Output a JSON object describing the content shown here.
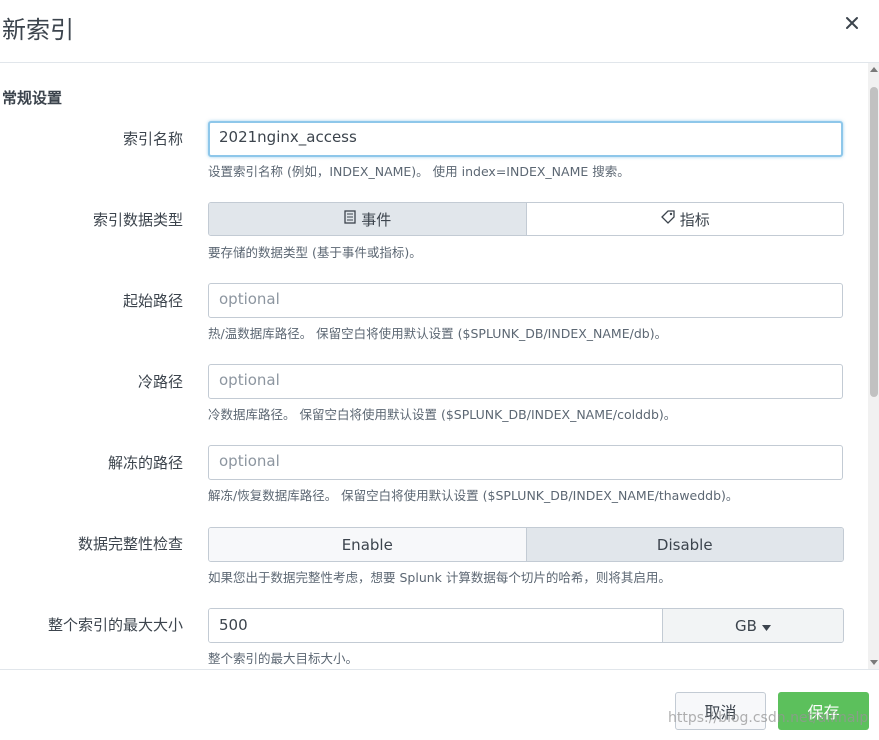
{
  "dialog": {
    "title": "新索引",
    "close_icon": "close-icon"
  },
  "section": {
    "title": "常规设置"
  },
  "index_name": {
    "label": "索引名称",
    "value": "2021nginx_access",
    "help": "设置索引名称 (例如，INDEX_NAME)。 使用 index=INDEX_NAME 搜索。"
  },
  "data_type": {
    "label": "索引数据类型",
    "options": [
      {
        "label": "事件",
        "icon": "document-icon",
        "selected": true
      },
      {
        "label": "指标",
        "icon": "tag-icon",
        "selected": false
      }
    ],
    "help": "要存储的数据类型 (基于事件或指标)。"
  },
  "home_path": {
    "label": "起始路径",
    "placeholder": "optional",
    "help": "热/温数据库路径。 保留空白将使用默认设置 ($SPLUNK_DB/INDEX_NAME/db)。"
  },
  "cold_path": {
    "label": "冷路径",
    "placeholder": "optional",
    "help": "冷数据库路径。 保留空白将使用默认设置 ($SPLUNK_DB/INDEX_NAME/colddb)。"
  },
  "thawed_path": {
    "label": "解冻的路径",
    "placeholder": "optional",
    "help": "解冻/恢复数据库路径。 保留空白将使用默认设置 ($SPLUNK_DB/INDEX_NAME/thaweddb)。"
  },
  "integrity": {
    "label": "数据完整性检查",
    "options": [
      {
        "label": "Enable",
        "selected": false
      },
      {
        "label": "Disable",
        "selected": true
      }
    ],
    "help": "如果您出于数据完整性考虑，想要 Splunk 计算数据每个切片的哈希，则将其启用。"
  },
  "max_size": {
    "label": "整个索引的最大大小",
    "value": "500",
    "unit": "GB",
    "help": "整个索引的最大目标大小。"
  },
  "footer": {
    "cancel_label": "取消",
    "save_label": "保存",
    "watermark": "https://blog.csdn.net/allinalp"
  }
}
